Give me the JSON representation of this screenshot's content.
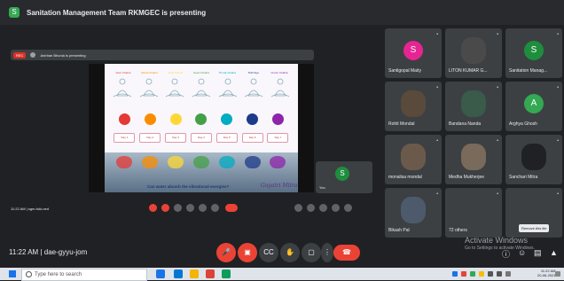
{
  "meeting": {
    "presenting_banner": "Sanitation Management Team RKMGEC is presenting",
    "presenting_badge": "S",
    "presenter_chip": {
      "rec": "REC",
      "name": "Anirban Bhunia is presenting"
    },
    "slide": {
      "chakra_labels": [
        "Root Chakra",
        "Sacral Chakra",
        "Solar Plexus",
        "Heart Chakra",
        "Throat Chakra",
        "Third Eye",
        "Crown Chakra"
      ],
      "chakra_colors": [
        "#e53935",
        "#fb8c00",
        "#fdd835",
        "#43a047",
        "#00acc1",
        "#1e3a8a",
        "#8e24aa"
      ],
      "days": [
        "Day 1",
        "Day 2",
        "Day 3",
        "Day 4",
        "Day 5",
        "Day 6",
        "Day 7"
      ],
      "question": "Can water absorb the vibrational energies?",
      "signature": "Gayatri Mitra"
    },
    "self_tile": {
      "initial": "S",
      "label": "You"
    },
    "inner_controls": {
      "time": "11:22 AM",
      "code": "sgm-fuki-ned"
    },
    "participants": [
      {
        "name": "Santigopal Maity",
        "initial": "S",
        "color": "#e52592",
        "photo": false
      },
      {
        "name": "LITON KUMAR G...",
        "initial": "",
        "color": "#4a4a4a",
        "photo": true
      },
      {
        "name": "Sanitation Manag...",
        "initial": "S",
        "color": "#1e8e3e",
        "photo": false
      },
      {
        "name": "Rohit Mondal",
        "initial": "",
        "color": "#5a4a3c",
        "photo": true
      },
      {
        "name": "Bandana Nanda",
        "initial": "",
        "color": "#3a5a4a",
        "photo": true
      },
      {
        "name": "Arghya Ghosh",
        "initial": "A",
        "color": "#34a853",
        "photo": false
      },
      {
        "name": "monalisa mondal",
        "initial": "",
        "color": "#6b5a4c",
        "photo": true
      },
      {
        "name": "Medha Mukherjee",
        "initial": "",
        "color": "#7a6a5c",
        "photo": true
      },
      {
        "name": "Sanchari Mitra",
        "initial": "",
        "color": "#202124",
        "photo": true
      },
      {
        "name": "Bikash Pal",
        "initial": "",
        "color": "#4c5a6b",
        "photo": true
      },
      {
        "name": "72 others",
        "initial": "",
        "color": "#3c4043",
        "photo": false
      },
      {
        "name": "",
        "initial": "",
        "color": "#3c4043",
        "photo": false
      }
    ],
    "tooltip": "Remove this tile",
    "bottom": {
      "time": "11:22 AM",
      "separator": "|",
      "code": "dae-gyyu-jom"
    },
    "activate": {
      "title": "Activate Windows",
      "subtitle": "Go to Settings to activate Windows."
    }
  },
  "taskbar": {
    "search_placeholder": "Type here to search",
    "clock_time": "11:22 AM",
    "clock_date": "20-06-2021"
  }
}
